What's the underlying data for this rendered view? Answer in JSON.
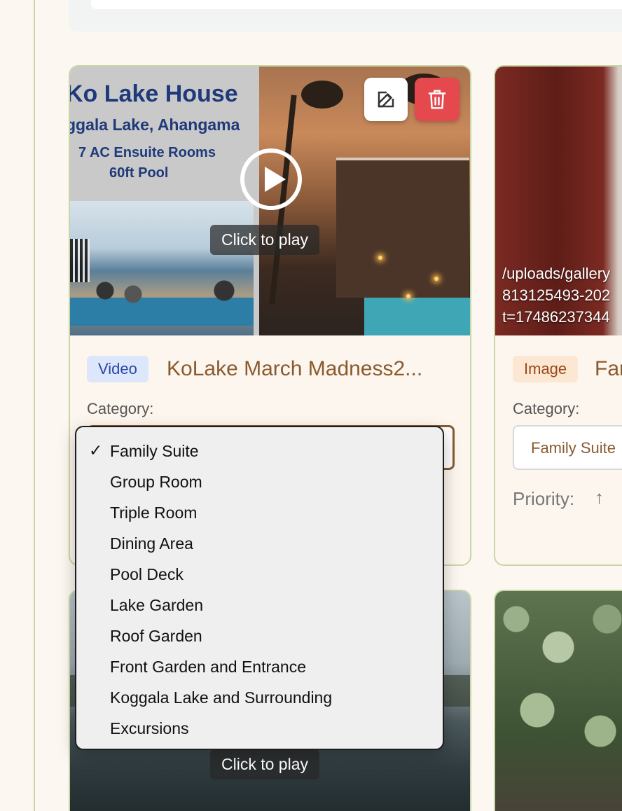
{
  "cards": [
    {
      "type": "Video",
      "title": "KoLake March Madness2...",
      "media": {
        "poster_title": "Ko Lake House",
        "poster_subtitle": "ggala Lake, Ahangama",
        "poster_line1": "7 AC Ensuite Rooms",
        "poster_line2": "60ft Pool",
        "overlay_text": "Click to play"
      },
      "category_label": "Category:",
      "category_value": "Family Suite"
    },
    {
      "type": "Image",
      "title": "Far",
      "media": {
        "path_lines": [
          "/uploads/gallery",
          "813125493-202",
          "t=17486237344"
        ]
      },
      "category_label": "Category:",
      "category_value": "Family Suite",
      "priority_label": "Priority:",
      "priority_icon": "↑"
    },
    {
      "media": {
        "overlay_text": "Click to play"
      }
    },
    {}
  ],
  "dropdown": {
    "selected_index": 0,
    "check_mark": "✓",
    "options": [
      "Family Suite",
      "Group Room",
      "Triple Room",
      "Dining Area",
      "Pool Deck",
      "Lake Garden",
      "Roof Garden",
      "Front Garden and Entrance",
      "Koggala Lake and Surrounding",
      "Excursions"
    ]
  },
  "icons": {
    "edit": "edit-icon",
    "delete": "trash-icon",
    "play": "play-icon"
  },
  "colors": {
    "page_bg": "#fcf7f0",
    "card_border": "#c8d6a8",
    "accent_brown": "#8a5a2e",
    "delete_red": "#e5484d",
    "video_badge_bg": "#dde7fb",
    "image_badge_bg": "#fce7d2"
  }
}
